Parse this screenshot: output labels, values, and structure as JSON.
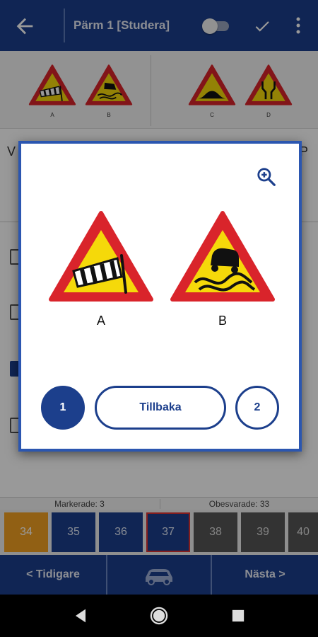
{
  "appbar": {
    "title": "Pärm 1 [Studera]",
    "icons": [
      "back-arrow-icon",
      "toggle-switch",
      "check-icon",
      "more-vert-icon"
    ]
  },
  "strip": {
    "labels": [
      "A",
      "B",
      "C",
      "D"
    ]
  },
  "question": {
    "left_letter": "V",
    "right_letter": "P"
  },
  "stats": {
    "marked": "Markerade: 3",
    "unanswered": "Obesvarade: 33"
  },
  "numbers": [
    "34",
    "35",
    "36",
    "37",
    "38",
    "39",
    "40"
  ],
  "nav": {
    "prev": "< Tidigare",
    "next": "Nästa >"
  },
  "dialog": {
    "label_a": "A",
    "label_b": "B",
    "page_1": "1",
    "back": "Tillbaka",
    "page_2": "2"
  },
  "colors": {
    "primary": "#1c3f8c",
    "sign_red": "#d9242b",
    "sign_yellow": "#f5d90a",
    "orange": "#f2a122"
  }
}
